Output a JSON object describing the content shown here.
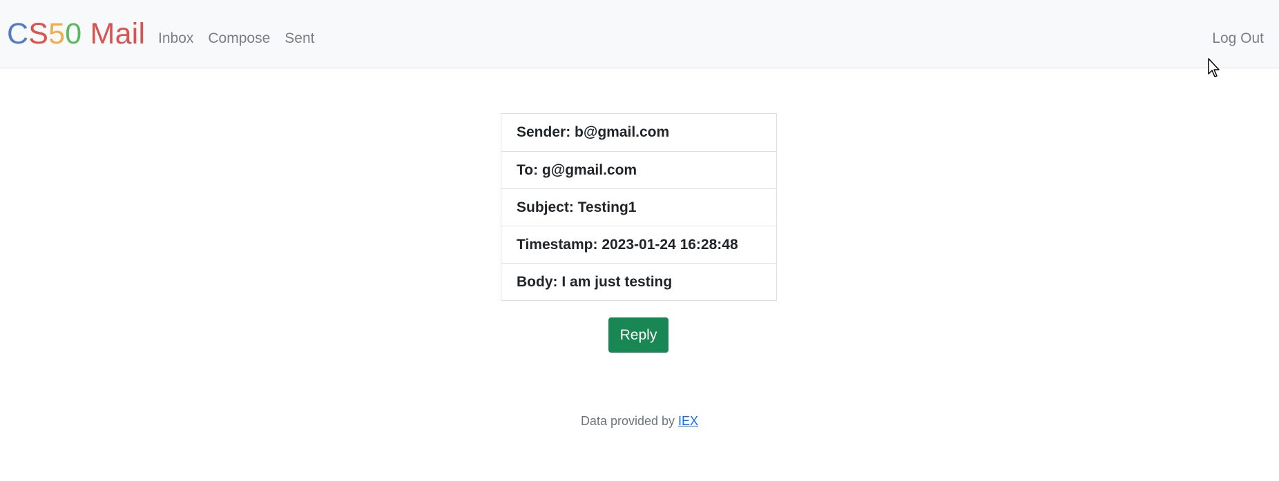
{
  "navbar": {
    "brand": {
      "parts": [
        {
          "text": "C",
          "color": "#537bc4"
        },
        {
          "text": "S",
          "color": "#d9534f"
        },
        {
          "text": "5",
          "color": "#f0ad4e"
        },
        {
          "text": "0",
          "color": "#5cb85c"
        },
        {
          "text": " Mail",
          "color": "#d9534f"
        }
      ]
    },
    "links": [
      "Inbox",
      "Compose",
      "Sent"
    ],
    "logout": "Log Out"
  },
  "email": {
    "sender": "Sender: b@gmail.com",
    "to": "To: g@gmail.com",
    "subject": "Subject: Testing1",
    "timestamp": "Timestamp: 2023-01-24 16:28:48",
    "body": "Body: I am just testing"
  },
  "reply_label": "Reply",
  "footer": {
    "text": "Data provided by ",
    "link": "IEX"
  },
  "colors": {
    "reply_button": "#198754",
    "navbar_bg": "#f8f9fa"
  }
}
